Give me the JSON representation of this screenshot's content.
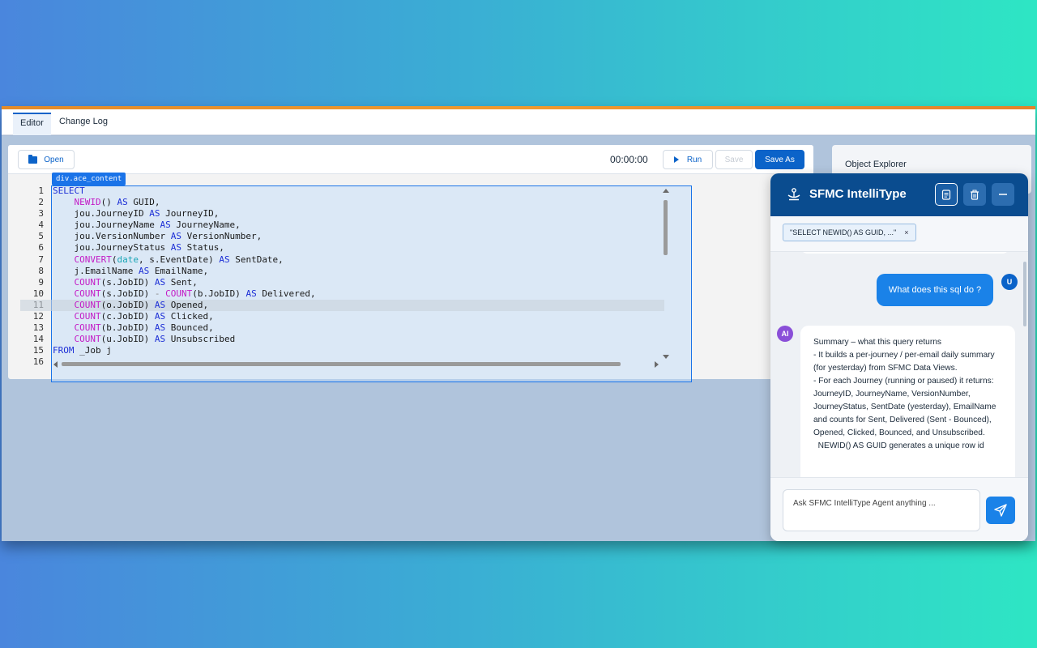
{
  "tabs": [
    {
      "label": "Editor",
      "active": true
    },
    {
      "label": "Change Log",
      "active": false
    }
  ],
  "toolbar": {
    "open_label": "Open",
    "timer": "00:00:00",
    "run_label": "Run",
    "save_label": "Save",
    "save_as_label": "Save As"
  },
  "editor": {
    "element_tag": "div.ace_content",
    "active_line": 11,
    "line_numbers": [
      "1",
      "2",
      "3",
      "4",
      "5",
      "6",
      "7",
      "8",
      "9",
      "10",
      "11",
      "12",
      "13",
      "14",
      "15",
      "16"
    ]
  },
  "object_explorer": {
    "title": "Object Explorer"
  },
  "chat": {
    "title": "SFMC IntelliType",
    "context_chip": "\"SELECT NEWID() AS GUID, ...\"",
    "chip_close": "×",
    "user_avatar": "U",
    "ai_avatar": "AI",
    "user_message": "What does this sql do ?",
    "ai_message": [
      "Summary – what this query returns",
      "- It builds a per-journey / per-email daily summary (for yesterday) from SFMC Data Views.",
      "- For each Journey (running or paused) it returns: JourneyID, JourneyName, VersionNumber, JourneyStatus, SentDate (yesterday), EmailName and counts for Sent, Delivered (Sent - Bounced), Opened, Clicked, Bounced, and Unsubscribed.",
      "  NEWID() AS GUID generates a unique row id"
    ],
    "input_placeholder": "Ask SFMC IntelliType Agent anything ..."
  },
  "colors": {
    "accent": "#0b63c9",
    "chat_header": "#0a4c8f",
    "user_bubble": "#1a82e8",
    "ai_avatar": "#8a4fd8",
    "keyword": "#1d2fd6",
    "function": "#c31bc6",
    "type": "#18a5b5"
  }
}
